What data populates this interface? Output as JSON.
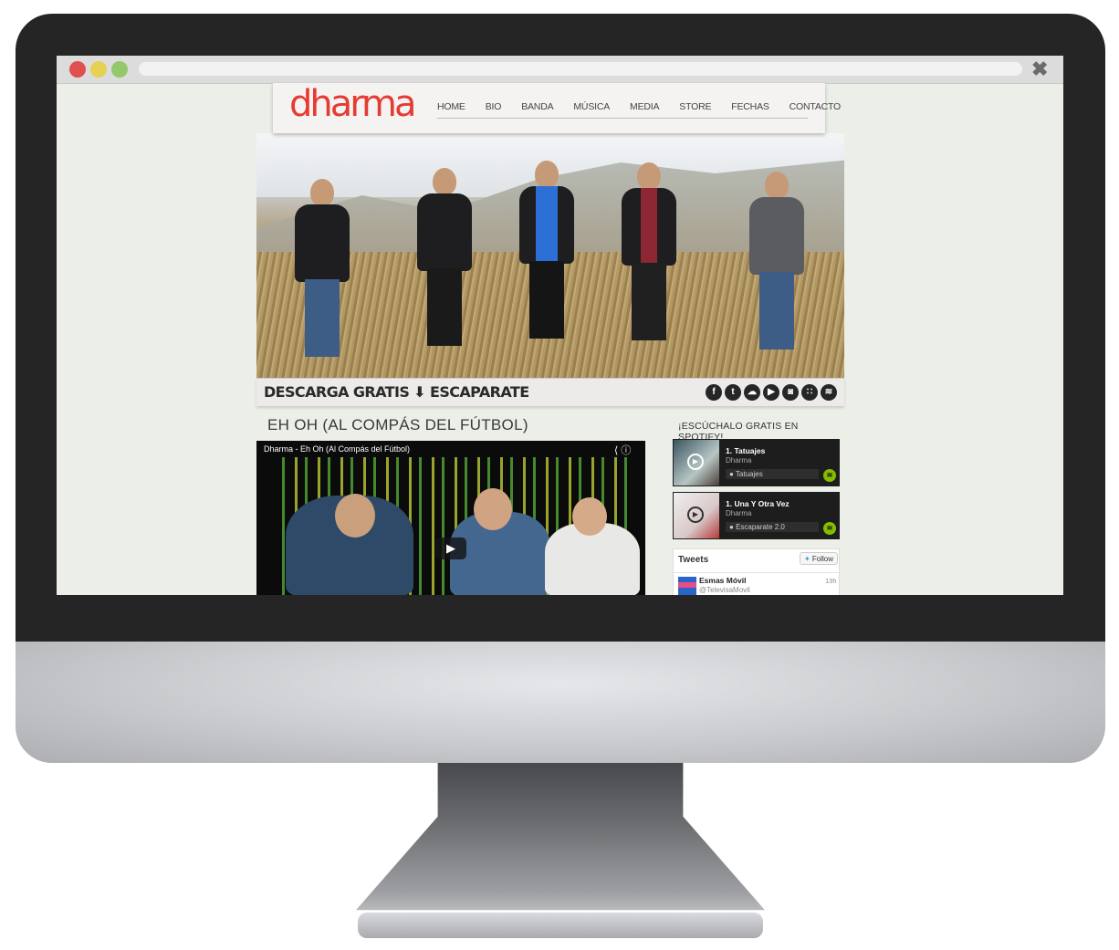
{
  "browser": {
    "dots": [
      "#e0504f",
      "#e7d152",
      "#93c86b"
    ]
  },
  "site": {
    "logo": "dharma",
    "nav": [
      "HOME",
      "BIO",
      "BANDA",
      "MÚSICA",
      "MEDIA",
      "STORE",
      "FECHAS",
      "CONTACTO"
    ],
    "download_text": "DESCARGA GRATIS ⬇ ESCAPARATE",
    "social_icons": [
      "facebook-icon",
      "twitter-icon",
      "soundcloud-icon",
      "youtube-icon",
      "instagram-icon",
      "myspace-icon",
      "spotify-icon"
    ],
    "video_section_title": "EH OH (AL COMPÁS DEL FÚTBOL)",
    "video_title": "Dharma - Eh Oh (Al Compás del Fútbol)",
    "spotify_heading": "¡ESCÚCHALO GRATIS EN SPOTIFY!",
    "spotify_cards": [
      {
        "track": "1. Tatuajes",
        "artist": "Dharma",
        "album": "Tatuajes"
      },
      {
        "track": "1. Una Y Otra Vez",
        "artist": "Dharma",
        "album": "Escaparate 2.0"
      }
    ],
    "tweets": {
      "title": "Tweets",
      "follow": "Follow",
      "name": "Esmas Móvil",
      "handle": "@TelevisaMovil",
      "time": "13h"
    }
  }
}
